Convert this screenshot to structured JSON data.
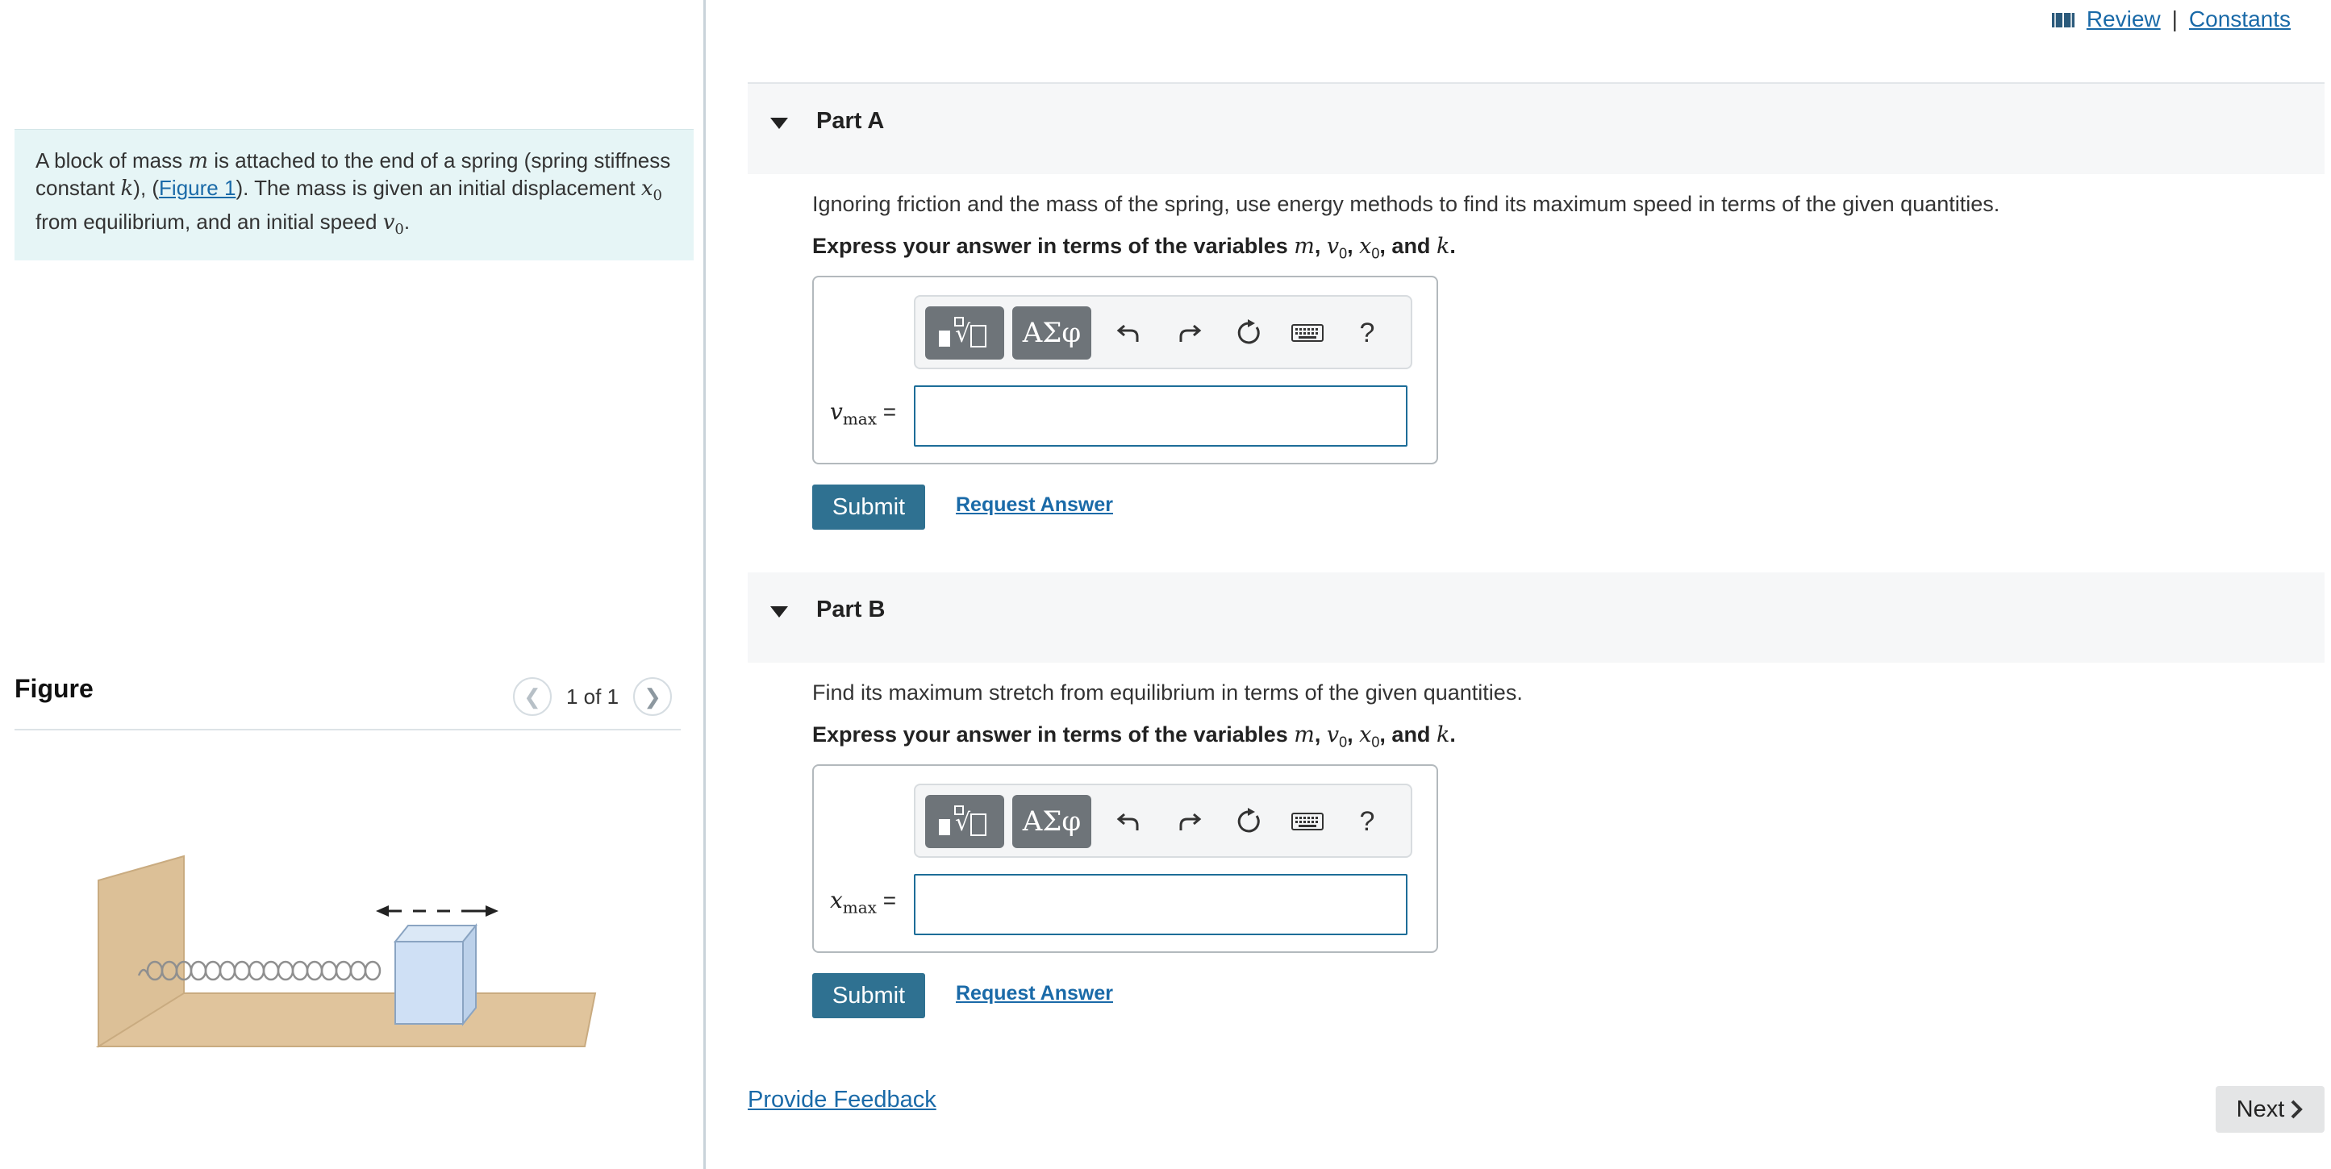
{
  "problem": {
    "t1": "A block of mass ",
    "m": "m",
    "t2": " is attached to the end of a spring (spring stiffness constant ",
    "k": "k",
    "t3": "), (",
    "fig_link": "Figure 1",
    "t4": "). The mass is given an initial displacement ",
    "x": "x",
    "x_sub": "0",
    "t5": " from equilibrium, and an initial speed ",
    "v": "v",
    "v_sub": "0",
    "t6": "."
  },
  "figure": {
    "title": "Figure",
    "counter": "1 of 1",
    "prev_icon": "chevron-left-icon",
    "next_icon": "chevron-right-icon"
  },
  "top_links": {
    "review": "Review",
    "separator": "|",
    "constants": "Constants",
    "book_icon": "book-icon"
  },
  "parts": [
    {
      "title": "Part A",
      "question": "Ignoring friction and the mass of the spring, use energy methods to find its maximum speed in terms of the given quantities.",
      "express_pre": "Express your answer in terms of the variables ",
      "var_m": "m",
      "var_v": "v",
      "var_v_sub": "0",
      "var_x": "x",
      "var_x_sub": "0",
      "express_and": ", and ",
      "var_k": "k",
      "period": ".",
      "answer_var": "v",
      "answer_var_sub": "max",
      "equals": "=",
      "answer_value": "",
      "submit": "Submit",
      "request": "Request Answer"
    },
    {
      "title": "Part B",
      "question": "Find its maximum stretch from equilibrium in terms of the given quantities.",
      "express_pre": "Express your answer in terms of the variables ",
      "var_m": "m",
      "var_v": "v",
      "var_v_sub": "0",
      "var_x": "x",
      "var_x_sub": "0",
      "express_and": ", and ",
      "var_k": "k",
      "period": ".",
      "answer_var": "x",
      "answer_var_sub": "max",
      "equals": "=",
      "answer_value": "",
      "submit": "Submit",
      "request": "Request Answer"
    }
  ],
  "toolbar": {
    "greek": "ΑΣφ",
    "help": "?",
    "icons": [
      "template-icon",
      "undo-icon",
      "redo-icon",
      "reset-icon",
      "keyboard-icon",
      "help-icon"
    ]
  },
  "footer": {
    "feedback": "Provide Feedback",
    "next": "Next",
    "next_icon": "chevron-right-icon"
  },
  "colors": {
    "accent": "#2f7191",
    "link": "#1a6aa8",
    "problem_bg": "#e6f5f6",
    "input_border": "#1d6d98"
  }
}
